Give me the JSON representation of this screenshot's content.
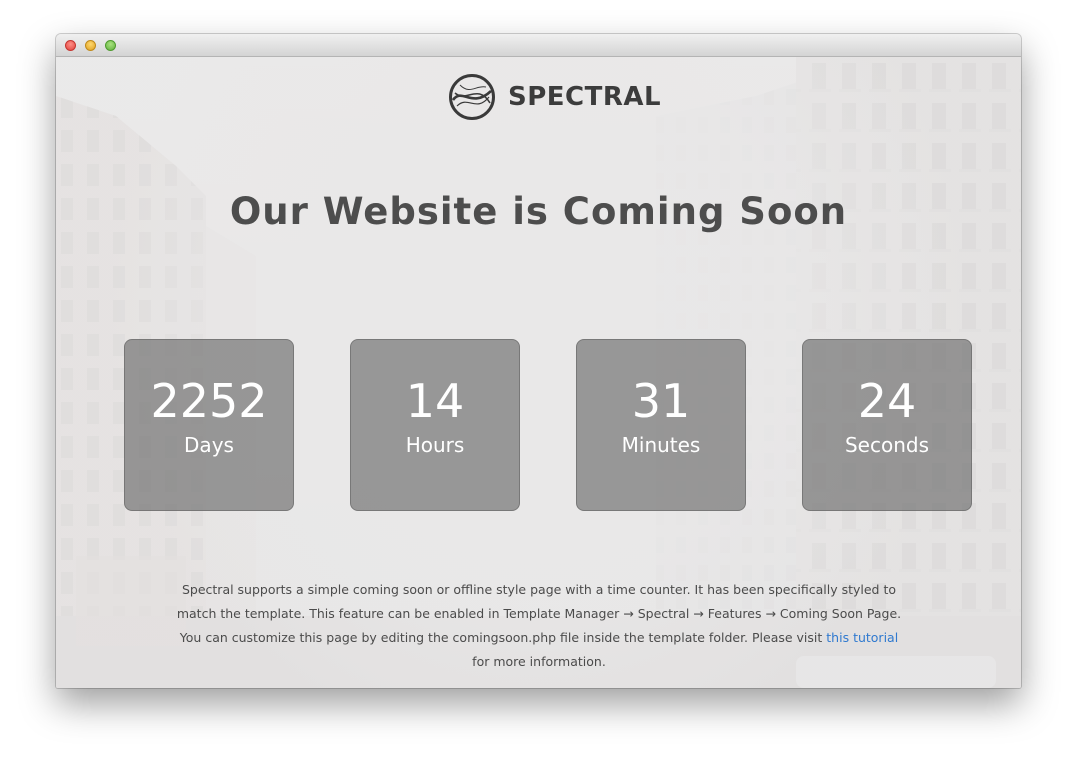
{
  "logo": {
    "name": "SPECTRAL"
  },
  "headline": "Our Website is Coming Soon",
  "countdown": [
    {
      "value": "2252",
      "unit": "Days"
    },
    {
      "value": "14",
      "unit": "Hours"
    },
    {
      "value": "31",
      "unit": "Minutes"
    },
    {
      "value": "24",
      "unit": "Seconds"
    }
  ],
  "description": {
    "before_link": "Spectral supports a simple coming soon or offline style page with a time counter. It has been specifically styled to match the template. This feature can be enabled in Template Manager → Spectral → Features → Coming Soon Page. You can customize this page by editing the comingsoon.php file inside the template folder. Please visit",
    "link_text": "this tutorial",
    "after_link": "for more information."
  },
  "colors": {
    "heading": "#4d4d4d",
    "counter_bg": "#707070",
    "link": "#2f79cf"
  }
}
